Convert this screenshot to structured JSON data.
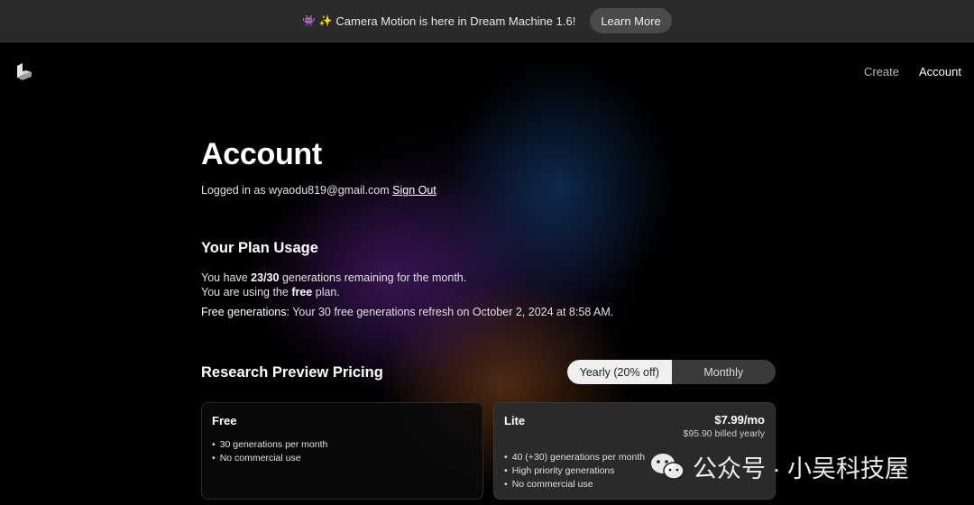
{
  "banner": {
    "emoji": "👾 ✨",
    "text": "Camera Motion is here in Dream Machine 1.6!",
    "button": "Learn More"
  },
  "nav": {
    "create": "Create",
    "account": "Account"
  },
  "account": {
    "title": "Account",
    "logged_prefix": "Logged in as wyaodu819@gmail.com",
    "sign_out": "Sign Out"
  },
  "usage": {
    "heading": "Your Plan Usage",
    "remaining_prefix": "You have",
    "remaining_value": "23/30",
    "remaining_suffix": "generations remaining for the month.",
    "plan_prefix": "You are using the",
    "plan_name": "free",
    "plan_suffix": "plan.",
    "refresh_label": "Free generations:",
    "refresh_text": "Your 30 free generations refresh on October 2, 2024 at 8:58 AM."
  },
  "pricing": {
    "heading": "Research Preview Pricing",
    "toggle": {
      "yearly": "Yearly (20% off)",
      "monthly": "Monthly",
      "selected": "yearly"
    },
    "plans": [
      {
        "name": "Free",
        "features": [
          "30 generations per month",
          "No commercial use"
        ]
      },
      {
        "name": "Lite",
        "price": "$7.99/mo",
        "billed": "$95.90 billed yearly",
        "features": [
          "40 (+30) generations per month",
          "High priority generations",
          "No commercial use"
        ]
      }
    ]
  },
  "watermark": {
    "text": "公众号 · 小吴科技屋",
    "icon": "wechat-icon"
  }
}
